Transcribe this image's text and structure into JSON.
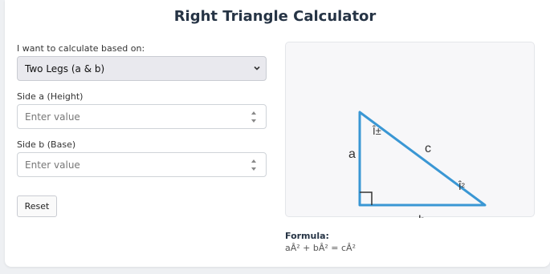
{
  "header": {
    "title": "Right Triangle Calculator"
  },
  "form": {
    "mode_label": "I want to calculate based on:",
    "mode_selected": "Two Legs (a & b)",
    "side_a_label": "Side a (Height)",
    "side_a_placeholder": "Enter value",
    "side_b_label": "Side b (Base)",
    "side_b_placeholder": "Enter value",
    "reset_label": "Reset"
  },
  "diagram": {
    "label_a": "a",
    "label_b": "b",
    "label_c": "c",
    "label_alpha": "Î±",
    "label_beta": "Î²",
    "stroke_color": "#3a97d4"
  },
  "formula": {
    "title": "Formula:",
    "text": "aÂ² + bÂ² = cÂ²"
  },
  "icons": {
    "select_chevron": "chevron-down-icon",
    "spinner": "spinner-arrows-icon"
  }
}
